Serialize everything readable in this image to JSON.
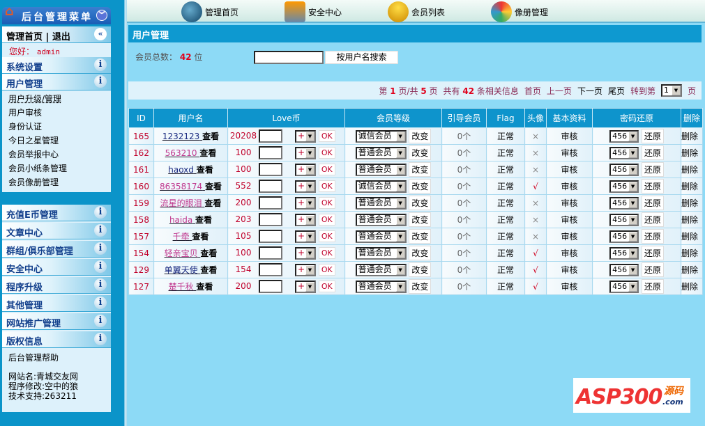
{
  "sidebar": {
    "title": "后台管理菜单",
    "home": "管理首页",
    "divider": "|",
    "logout": "退出",
    "greeting": "您好：",
    "user": "admin",
    "system_settings": "系统设置",
    "user_mgmt": "用户管理",
    "user_items": [
      "用户升级/管理",
      "用户审核",
      "身份认证",
      "今日之星管理",
      "会员举报中心",
      "会员小纸条管理",
      "会员像册管理"
    ],
    "sections": [
      "充值E币管理",
      "文章中心",
      "群组/俱乐部管理",
      "安全中心",
      "程序升级",
      "其他管理",
      "网站推广管理",
      "版权信息"
    ],
    "help": "后台管理帮助",
    "site_name": "网站名:青城交友网",
    "modified_by": "程序修改:空中的狼",
    "support": "技术支持:263211"
  },
  "topnav": [
    "管理首页",
    "安全中心",
    "会员列表",
    "像册管理"
  ],
  "page_title": "用户管理",
  "search": {
    "label": "会员总数：",
    "count": "42",
    "unit": "位",
    "button": "按用户名搜索",
    "value": ""
  },
  "pager": {
    "p1": "第",
    "page": "1",
    "p2": "页/共",
    "total_pages": "5",
    "p3": "页",
    "p4": "共有",
    "total": "42",
    "p5": "条相关信息",
    "first": "首页",
    "prev": "上一页",
    "next": "下一页",
    "last": "尾页",
    "goto": "转到第",
    "goto_value": "1",
    "goto_end": "页"
  },
  "table": {
    "headers": [
      "ID",
      "用户名",
      "Love币",
      "会员等级",
      "引导会员",
      "Flag",
      "头像",
      "基本资料",
      "密码还原",
      "删除"
    ],
    "view": "查看",
    "op": "+",
    "ok": "OK",
    "change": "改变",
    "restore": "还原",
    "delete": "删除",
    "pwd": "456",
    "rows": [
      {
        "id": "165",
        "name": "1232123",
        "visited": true,
        "love": "20208",
        "level": "诚信会员",
        "ref": "0个",
        "flag": "正常",
        "avatar": "×",
        "info": "审核"
      },
      {
        "id": "162",
        "name": "563210",
        "visited": false,
        "love": "100",
        "level": "普通会员",
        "ref": "0个",
        "flag": "正常",
        "avatar": "×",
        "info": "审核"
      },
      {
        "id": "161",
        "name": "haoxd",
        "visited": true,
        "love": "100",
        "level": "普通会员",
        "ref": "0个",
        "flag": "正常",
        "avatar": "×",
        "info": "审核"
      },
      {
        "id": "160",
        "name": "86358174",
        "visited": false,
        "love": "552",
        "level": "诚信会员",
        "ref": "0个",
        "flag": "正常",
        "avatar": "√",
        "info": "审核"
      },
      {
        "id": "159",
        "name": "流星的眼泪",
        "visited": false,
        "love": "200",
        "level": "普通会员",
        "ref": "0个",
        "flag": "正常",
        "avatar": "×",
        "info": "审核"
      },
      {
        "id": "158",
        "name": "haida",
        "visited": false,
        "love": "203",
        "level": "普通会员",
        "ref": "0个",
        "flag": "正常",
        "avatar": "×",
        "info": "审核"
      },
      {
        "id": "157",
        "name": "千牵",
        "visited": false,
        "love": "105",
        "level": "普通会员",
        "ref": "0个",
        "flag": "正常",
        "avatar": "×",
        "info": "审核"
      },
      {
        "id": "154",
        "name": "轻亲宝贝",
        "visited": false,
        "love": "100",
        "level": "普通会员",
        "ref": "0个",
        "flag": "正常",
        "avatar": "√",
        "info": "审核"
      },
      {
        "id": "129",
        "name": "单翼天使",
        "visited": true,
        "love": "154",
        "level": "普通会员",
        "ref": "0个",
        "flag": "正常",
        "avatar": "√",
        "info": "审核"
      },
      {
        "id": "127",
        "name": "楚千秋",
        "visited": false,
        "love": "200",
        "level": "普通会员",
        "ref": "0个",
        "flag": "正常",
        "avatar": "√",
        "info": "审核"
      }
    ]
  },
  "logo": {
    "text": "ASP300",
    "sub": "源码",
    ".com": ".com"
  },
  "colors": {
    "accent": "#0e99d0",
    "link_new": "#c0398f",
    "link_visited": "#1a2a80",
    "red": "#c0002a"
  }
}
